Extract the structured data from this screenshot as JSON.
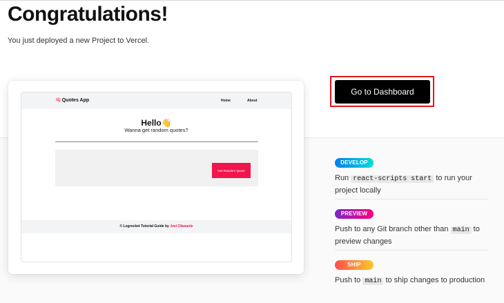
{
  "header": {
    "title": "Congratulations!",
    "subtitle": "You just deployed a new Project to Vercel."
  },
  "preview": {
    "app_name": "Quotes App",
    "app_icon": "brain-icon",
    "nav": {
      "home": "Home",
      "about": "About"
    },
    "hello": "Hello👋",
    "tagline": "Wanna get random quotes?",
    "quote_text": ".",
    "quote_button": "Get Random Quote",
    "footer_prefix": "© Logrocket Tutorial Guide by",
    "footer_author": "Joel Olawanle",
    "accent_color": "#f0154b"
  },
  "dashboard_button": "Go to Dashboard",
  "steps": [
    {
      "badge": "DEVELOP",
      "text_before": "Run",
      "code": "react-scripts start",
      "text_after": "to run your project locally"
    },
    {
      "badge": "PREVIEW",
      "text_before": "Push to any Git branch other than",
      "code": "main",
      "text_after": "to preview changes"
    },
    {
      "badge": "SHIP",
      "text_before": "Push to",
      "code": "main",
      "text_after": "to ship changes to production"
    }
  ],
  "colors": {
    "develop": [
      "#007cf0",
      "#00dfd8"
    ],
    "preview": [
      "#7928ca",
      "#ff0080"
    ],
    "ship": [
      "#ff4d4d",
      "#f9cb28"
    ],
    "highlight_outline": "#e3141b"
  }
}
